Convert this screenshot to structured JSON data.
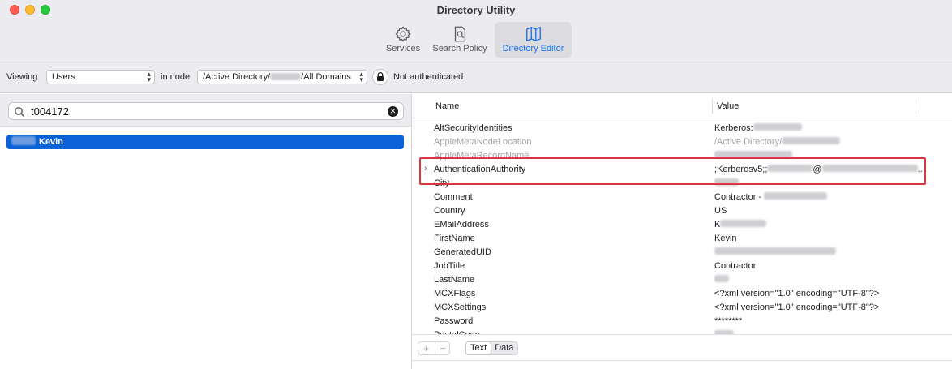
{
  "window": {
    "title": "Directory Utility"
  },
  "toolbar": {
    "services_label": "Services",
    "search_policy_label": "Search Policy",
    "directory_editor_label": "Directory Editor",
    "active": "Directory Editor"
  },
  "filter": {
    "viewing_label": "Viewing",
    "record_type": "Users",
    "in_node_label": "in node",
    "node_prefix": "/Active Directory/",
    "node_suffix": "/All Domains",
    "auth_status": "Not authenticated"
  },
  "search": {
    "value": "t004172"
  },
  "results": [
    {
      "name": "Kevin",
      "selected": true
    }
  ],
  "table": {
    "columns": [
      "Name",
      "Value"
    ],
    "rows": [
      {
        "name": "AltSecurityIdentities",
        "value": "Kerberos:",
        "dim": false,
        "blur": 100
      },
      {
        "name": "AppleMetaNodeLocation",
        "value": "/Active Directory/",
        "dim": true,
        "blur": 120
      },
      {
        "name": "AppleMetaRecordName",
        "value": "",
        "dim": true,
        "blur": 160
      },
      {
        "name": "AuthenticationAuthority",
        "value": ";Kerberosv5;;",
        "value_tail": "@",
        "value_end": "..",
        "dim": false,
        "blur": 0,
        "expandable": true
      },
      {
        "name": "City",
        "value": "",
        "dim": false,
        "blur": 50
      },
      {
        "name": "Comment",
        "value": "Contractor - ",
        "dim": false,
        "blur": 130
      },
      {
        "name": "Country",
        "value": "US",
        "dim": false,
        "blur": 0
      },
      {
        "name": "EMailAddress",
        "value": "K",
        "dim": false,
        "blur": 95
      },
      {
        "name": "FirstName",
        "value": "Kevin",
        "dim": false,
        "blur": 0
      },
      {
        "name": "GeneratedUID",
        "value": "",
        "dim": false,
        "blur": 250
      },
      {
        "name": "JobTitle",
        "value": "Contractor",
        "dim": false,
        "blur": 0
      },
      {
        "name": "LastName",
        "value": "",
        "dim": false,
        "blur": 30
      },
      {
        "name": "MCXFlags",
        "value": "<?xml version=\"1.0\" encoding=\"UTF-8\"?>",
        "dim": false,
        "blur": 0
      },
      {
        "name": "MCXSettings",
        "value": "<?xml version=\"1.0\" encoding=\"UTF-8\"?>",
        "dim": false,
        "blur": 0
      },
      {
        "name": "Password",
        "value": "********",
        "dim": false,
        "blur": 0
      },
      {
        "name": "PostalCode",
        "value": "",
        "dim": false,
        "blur": 40
      }
    ]
  },
  "bottom": {
    "plus": "+",
    "minus": "−",
    "text_tab": "Text",
    "data_tab": "Data"
  },
  "colors": {
    "accent": "#0a62d6",
    "highlight_box": "#d9363e"
  }
}
